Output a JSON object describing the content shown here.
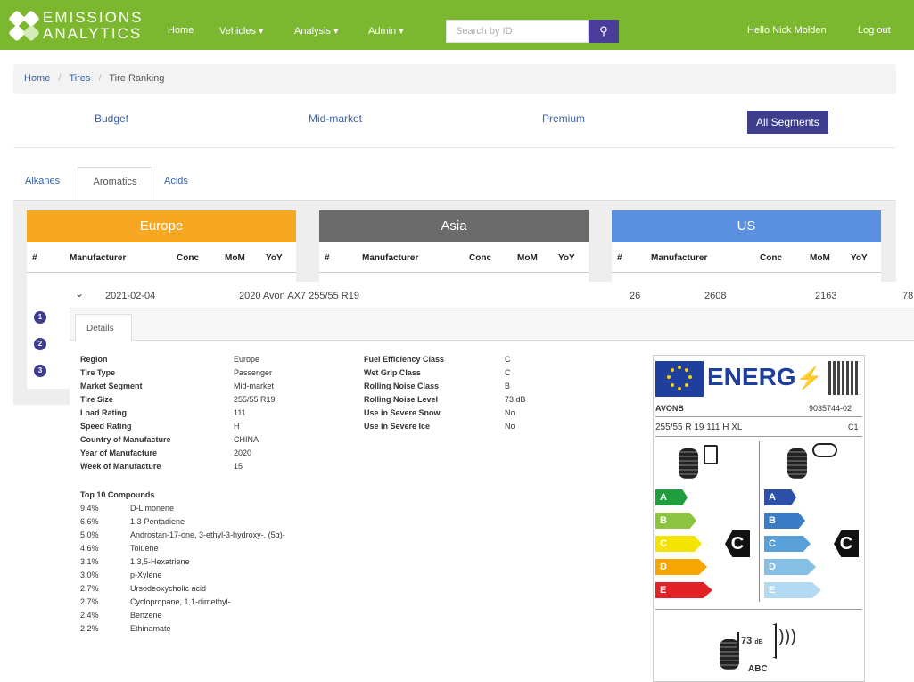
{
  "nav": {
    "logo_line1": "EMISSIONS",
    "logo_line2": "ANALYTICS",
    "home": "Home",
    "vehicles": "Vehicles ▾",
    "analysis": "Analysis ▾",
    "admin": "Admin ▾",
    "search_placeholder": "Search by ID",
    "greeting": "Hello Nick Molden",
    "logout": "Log out"
  },
  "breadcrumb": {
    "home": "Home",
    "sep": "/",
    "tires": "Tires",
    "current": "Tire Ranking"
  },
  "segments": [
    "Budget",
    "Mid-market",
    "Premium",
    "All Segments"
  ],
  "tabs": [
    "Alkanes",
    "Aromatics",
    "Acids"
  ],
  "regions": [
    {
      "name": "Europe",
      "color": "#f7a823"
    },
    {
      "name": "Asia",
      "color": "#6b6b6b"
    },
    {
      "name": "US",
      "color": "#5b8fe0"
    }
  ],
  "columns": {
    "num": "#",
    "manufacturer": "Manufacturer",
    "conc": "Conc",
    "mom": "MoM",
    "yoy": "YoY"
  },
  "rank_badges": [
    "1",
    "2",
    "3"
  ],
  "row": {
    "date": "2021-02-04",
    "tire": "2020 Avon AX7 255/55 R19",
    "conc": "26",
    "mom": "2608",
    "yoy": "2163",
    "extra": "78"
  },
  "detail_tab": "Details",
  "specs_left": [
    {
      "k": "Region",
      "v": "Europe"
    },
    {
      "k": "Tire Type",
      "v": "Passenger"
    },
    {
      "k": "Market Segment",
      "v": "Mid-market"
    },
    {
      "k": "Tire Size",
      "v": "255/55 R19"
    },
    {
      "k": "Load Rating",
      "v": "111"
    },
    {
      "k": "Speed Rating",
      "v": "H"
    },
    {
      "k": "Country of Manufacture",
      "v": "CHINA"
    },
    {
      "k": "Year of Manufacture",
      "v": "2020"
    },
    {
      "k": "Week of Manufacture",
      "v": "15"
    }
  ],
  "specs_right": [
    {
      "k": "Fuel Efficiency Class",
      "v": "C"
    },
    {
      "k": "Wet Grip Class",
      "v": "C"
    },
    {
      "k": "Rolling Noise Class",
      "v": "B"
    },
    {
      "k": "Rolling Noise Level",
      "v": "73 dB"
    },
    {
      "k": "Use in Severe Snow",
      "v": "No"
    },
    {
      "k": "Use in Severe Ice",
      "v": "No"
    }
  ],
  "compounds_title": "Top 10 Compounds",
  "compounds": [
    {
      "p": "9.4%",
      "n": "D-Limonene"
    },
    {
      "p": "6.6%",
      "n": "1,3-Pentadiene"
    },
    {
      "p": "5.0%",
      "n": "Androstan-17-one, 3-ethyl-3-hydroxy-, (5α)-"
    },
    {
      "p": "4.6%",
      "n": "Toluene"
    },
    {
      "p": "3.1%",
      "n": "1,3,5-Hexatriene"
    },
    {
      "p": "3.0%",
      "n": "p-Xylene"
    },
    {
      "p": "2.7%",
      "n": "Ursodeoxycholic acid"
    },
    {
      "p": "2.7%",
      "n": "Cyclopropane, 1,1-dimethyl-"
    },
    {
      "p": "2.4%",
      "n": "Benzene"
    },
    {
      "p": "2.2%",
      "n": "Ethinamate"
    }
  ],
  "energy_label": {
    "title": "ENERG",
    "brand": "AVONB",
    "code": "9035744-02",
    "size": "255/55 R 19 111 H XL",
    "cls": "C1",
    "fuel_letters": [
      "A",
      "B",
      "C",
      "D",
      "E"
    ],
    "wet_letters": [
      "A",
      "B",
      "C",
      "D",
      "E"
    ],
    "fuel_class": "C",
    "wet_class": "C",
    "noise_db": "73",
    "noise_unit": "dB",
    "noise_classes": "ABC",
    "fuel_colors": [
      "#1f9e3d",
      "#8cc43f",
      "#f5e400",
      "#f7a500",
      "#e32228"
    ],
    "wet_colors": [
      "#2c4fa8",
      "#3b7cc6",
      "#5aa0d8",
      "#86bfe6",
      "#b2dbf3"
    ]
  }
}
